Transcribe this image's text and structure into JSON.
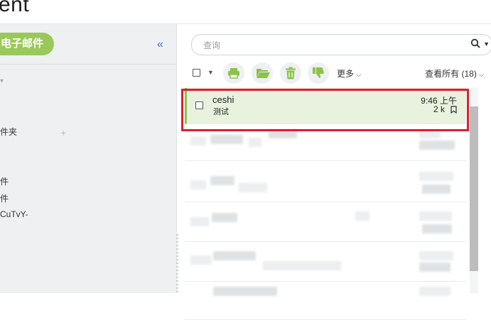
{
  "brand": {
    "text": "ent",
    "mark": "®"
  },
  "sidebar": {
    "compose_label": "电子邮件",
    "collapse_glyph": "«",
    "items": [
      {
        "label": "件夹"
      },
      {
        "label": "件"
      },
      {
        "label": "件"
      },
      {
        "label": "CuTvY-"
      }
    ],
    "add_glyph": "+"
  },
  "search": {
    "placeholder": "查询"
  },
  "toolbar": {
    "more_label": "更多",
    "view_all_label": "查看所有 (18)"
  },
  "messages": [
    {
      "sender": "ceshi",
      "subject": "测试",
      "time": "9:46 上午",
      "size": "2 k"
    }
  ],
  "colors": {
    "accent": "#9bc85b",
    "selected_row": "#e8f2de",
    "highlight": "#e01e2b",
    "link": "#3b78c4"
  }
}
